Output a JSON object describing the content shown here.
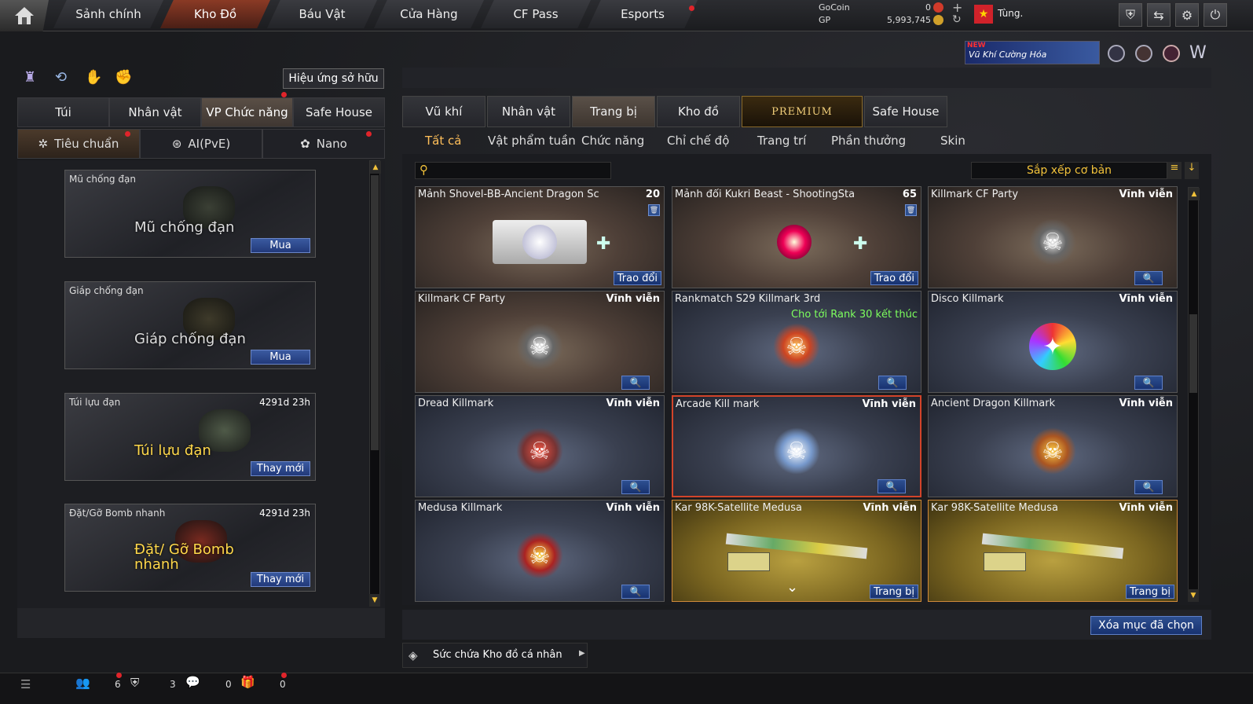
{
  "nav": {
    "tabs": [
      "Sảnh chính",
      "Kho Đồ",
      "Báu Vật",
      "Cửa Hàng",
      "CF Pass",
      "Esports"
    ],
    "active": "Kho Đồ"
  },
  "currency": {
    "gocoin_label": "GoCoin",
    "gocoin_value": "0",
    "gp_label": "GP",
    "gp_value": "5,993,745"
  },
  "user": {
    "name": "Tùng."
  },
  "banner": {
    "new": "NEW",
    "text": "Vũ Khí Cường Hóa"
  },
  "left": {
    "effect_button": "Hiệu ứng sở hữu",
    "tabs": [
      "Túi",
      "Nhân vật",
      "VP Chức năng",
      "Safe House"
    ],
    "subtabs": [
      "Tiêu chuẩn",
      "AI(PvE)",
      "Nano"
    ],
    "items": [
      {
        "title": "Mũ chống đạn",
        "time": "",
        "big": "Mũ chống đạn",
        "button": "Mua"
      },
      {
        "title": "Giáp chống đạn",
        "time": "",
        "big": "Giáp chống đạn",
        "button": "Mua"
      },
      {
        "title": "Túi lựu đạn",
        "time": "4291d 23h",
        "big": "Túi lựu đạn",
        "button": "Thay mới"
      },
      {
        "title": "Đặt/Gỡ Bomb nhanh",
        "time": "4291d 23h",
        "big": "Đặt/ Gỡ Bomb nhanh",
        "button": "Thay mới"
      }
    ]
  },
  "right": {
    "tabs": [
      "Vũ khí",
      "Nhân vật",
      "Trang bị",
      "Kho đồ",
      "PREMIUM",
      "Safe House"
    ],
    "subtabs": [
      "Tất cả",
      "Vật phẩm tuần",
      "Chức năng",
      "Chỉ chế độ",
      "Trang trí",
      "Phần thưởng",
      "Skin"
    ],
    "sort": "Sắp xếp cơ bản",
    "search_placeholder": "",
    "cards": [
      {
        "name": "Mảnh Shovel-BB-Ancient Dragon Sc",
        "right": "20",
        "action": "Trao đổi",
        "note": ""
      },
      {
        "name": "Mảnh đổi Kukri Beast - ShootingSta",
        "right": "65",
        "action": "Trao đổi",
        "note": ""
      },
      {
        "name": "Killmark CF Party",
        "right": "Vĩnh viễn",
        "action": "",
        "note": ""
      },
      {
        "name": "Killmark CF Party",
        "right": "Vĩnh viễn",
        "action": "",
        "note": ""
      },
      {
        "name": "Rankmatch S29 Killmark 3rd",
        "right": "",
        "action": "",
        "note": "Cho tới Rank 30 kết thúc"
      },
      {
        "name": "Disco Killmark",
        "right": "Vĩnh viễn",
        "action": "",
        "note": ""
      },
      {
        "name": "Dread Killmark",
        "right": "Vĩnh viễn",
        "action": "",
        "note": ""
      },
      {
        "name": "Arcade Kill mark",
        "right": "Vĩnh viễn",
        "action": "",
        "note": ""
      },
      {
        "name": "Ancient Dragon Killmark",
        "right": "Vĩnh viễn",
        "action": "",
        "note": ""
      },
      {
        "name": "Medusa Killmark",
        "right": "Vĩnh viễn",
        "action": "",
        "note": ""
      },
      {
        "name": "Kar 98K-Satellite Medusa",
        "right": "Vĩnh viễn",
        "action": "Trang bị",
        "note": ""
      },
      {
        "name": "Kar 98K-Satellite Medusa",
        "right": "Vĩnh viễn",
        "action": "Trang bị",
        "note": ""
      }
    ],
    "delete_button": "Xóa mục đã chọn",
    "capacity": "Sức chứa Kho đồ cá nhân"
  },
  "bottom": {
    "c1": "6",
    "c2": "3",
    "c3": "0",
    "c4": "0"
  }
}
